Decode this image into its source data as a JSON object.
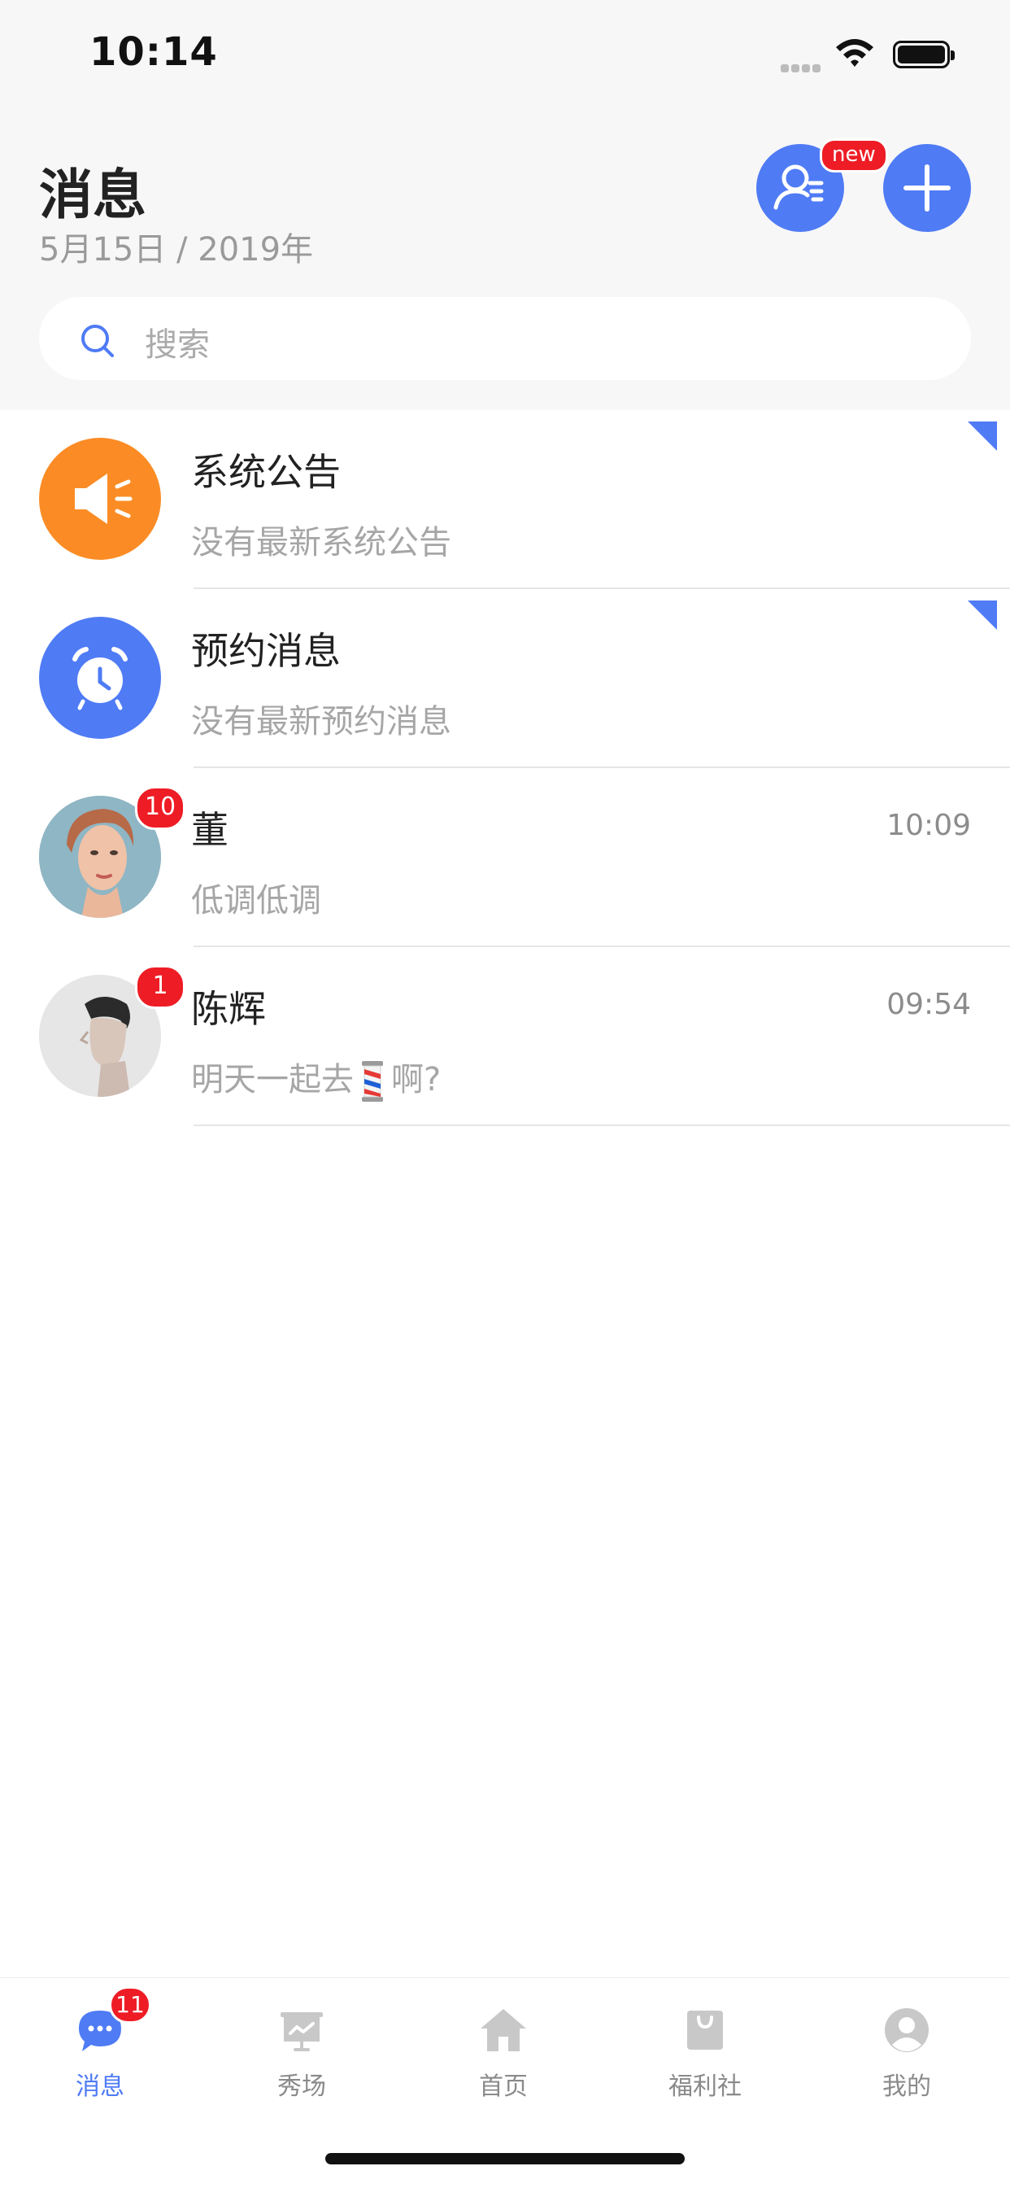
{
  "status_bar": {
    "time": "10:14"
  },
  "header": {
    "title": "消息",
    "date": "5月15日 / 2019年",
    "new_badge": "new",
    "contacts_icon": "contacts-icon",
    "add_icon": "plus-icon"
  },
  "search": {
    "placeholder": "搜索",
    "icon": "search-icon"
  },
  "items": [
    {
      "title": "系统公告",
      "subtitle": "没有最新系统公告",
      "icon": "megaphone-icon",
      "color": "#fb8c25"
    },
    {
      "title": "预约消息",
      "subtitle": "没有最新预约消息",
      "icon": "alarm-clock-icon",
      "color": "#4f7bf5"
    },
    {
      "title": "董",
      "subtitle": "低调低调",
      "time": "10:09",
      "badge": "10"
    },
    {
      "title": "陈辉",
      "subtitle_prefix": "明天一起去",
      "subtitle_emoji": "barber-pole-emoji",
      "subtitle_suffix": "啊?",
      "time": "09:54",
      "badge": "1"
    }
  ],
  "tabbar": {
    "tabs": [
      {
        "label": "消息",
        "icon": "chat-bubble-icon",
        "badge": "11",
        "active": true
      },
      {
        "label": "秀场",
        "icon": "showcase-board-icon"
      },
      {
        "label": "首页",
        "icon": "home-icon"
      },
      {
        "label": "福利社",
        "icon": "shopping-bag-icon"
      },
      {
        "label": "我的",
        "icon": "profile-icon"
      }
    ]
  },
  "colors": {
    "accent": "#4f7bf5",
    "orange": "#fb8c25",
    "badge": "#ee1c25"
  }
}
